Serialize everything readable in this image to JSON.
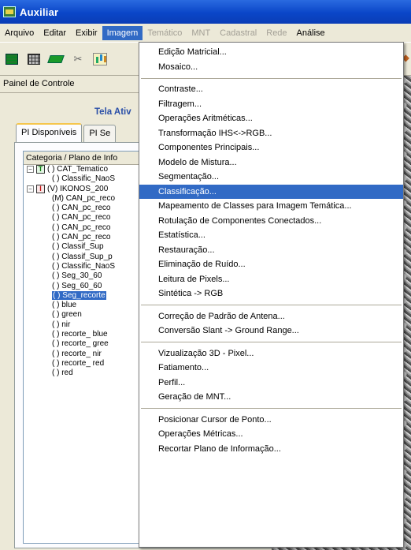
{
  "window": {
    "title": "Auxiliar"
  },
  "menubar": {
    "items": [
      {
        "label": "Arquivo",
        "state": "normal"
      },
      {
        "label": "Editar",
        "state": "normal"
      },
      {
        "label": "Exibir",
        "state": "normal"
      },
      {
        "label": "Imagem",
        "state": "active"
      },
      {
        "label": "Temático",
        "state": "disabled"
      },
      {
        "label": "MNT",
        "state": "disabled"
      },
      {
        "label": "Cadastral",
        "state": "disabled"
      },
      {
        "label": "Rede",
        "state": "disabled"
      },
      {
        "label": "Análise",
        "state": "normal"
      }
    ]
  },
  "panel": {
    "header": "Painel de Controle",
    "tela_ativa": "Tela Ativ",
    "tabs": [
      "PI Disponíveis",
      "PI Se"
    ],
    "tree_header": "Categoria / Plano de Info",
    "tree": [
      {
        "expander": "−",
        "box": "T",
        "text": "( ) CAT_Tematico"
      },
      {
        "indent": true,
        "text": "( ) Classific_NaoS"
      },
      {
        "expander": "−",
        "box": "I",
        "text": "(V) IKONOS_200"
      },
      {
        "indent": true,
        "text": "(M) CAN_pc_reco"
      },
      {
        "indent": true,
        "text": "( ) CAN_pc_reco"
      },
      {
        "indent": true,
        "text": "( ) CAN_pc_reco"
      },
      {
        "indent": true,
        "text": "( ) CAN_pc_reco"
      },
      {
        "indent": true,
        "text": "( ) CAN_pc_reco"
      },
      {
        "indent": true,
        "text": "( ) Classif_Sup"
      },
      {
        "indent": true,
        "text": "( ) Classif_Sup_p"
      },
      {
        "indent": true,
        "text": "( ) Classific_NaoS"
      },
      {
        "indent": true,
        "text": "( ) Seg_30_60"
      },
      {
        "indent": true,
        "text": "( ) Seg_60_60"
      },
      {
        "indent": true,
        "text": "( ) Seg_recorte",
        "selected": true
      },
      {
        "indent": true,
        "text": "( ) blue"
      },
      {
        "indent": true,
        "text": "( ) green"
      },
      {
        "indent": true,
        "text": "( ) nir"
      },
      {
        "indent": true,
        "text": "( ) recorte_ blue"
      },
      {
        "indent": true,
        "text": "( ) recorte_ gree"
      },
      {
        "indent": true,
        "text": "( ) recorte_ nir"
      },
      {
        "indent": true,
        "text": "( ) recorte_ red"
      },
      {
        "indent": true,
        "text": "( ) red"
      }
    ]
  },
  "dropdown": {
    "groups": [
      [
        "Edição Matricial...",
        "Mosaico..."
      ],
      [
        "Contraste...",
        "Filtragem...",
        "Operações Aritméticas...",
        "Transformação IHS<->RGB...",
        "Componentes Principais...",
        "Modelo de Mistura...",
        "Segmentação...",
        "Classificação...",
        "Mapeamento de Classes para Imagem Temática...",
        "Rotulação de Componentes Conectados...",
        "Estatística...",
        "Restauração...",
        "Eliminação de Ruído...",
        "Leitura de Pixels...",
        "Sintética -> RGB"
      ],
      [
        "Correção de Padrão de Antena...",
        "Conversão Slant -> Ground Range..."
      ],
      [
        "Vizualização 3D - Pixel...",
        "Fatiamento...",
        "Perfil...",
        "Geração de MNT..."
      ],
      [
        "Posicionar Cursor de Ponto...",
        "Operações Métricas...",
        "Recortar Plano de Informação..."
      ]
    ],
    "highlighted": "Classificação..."
  },
  "colors": {
    "highlight": "#316ac5",
    "titlebar": "#0a46c8",
    "tela_ativa": "#2a4fa8"
  }
}
